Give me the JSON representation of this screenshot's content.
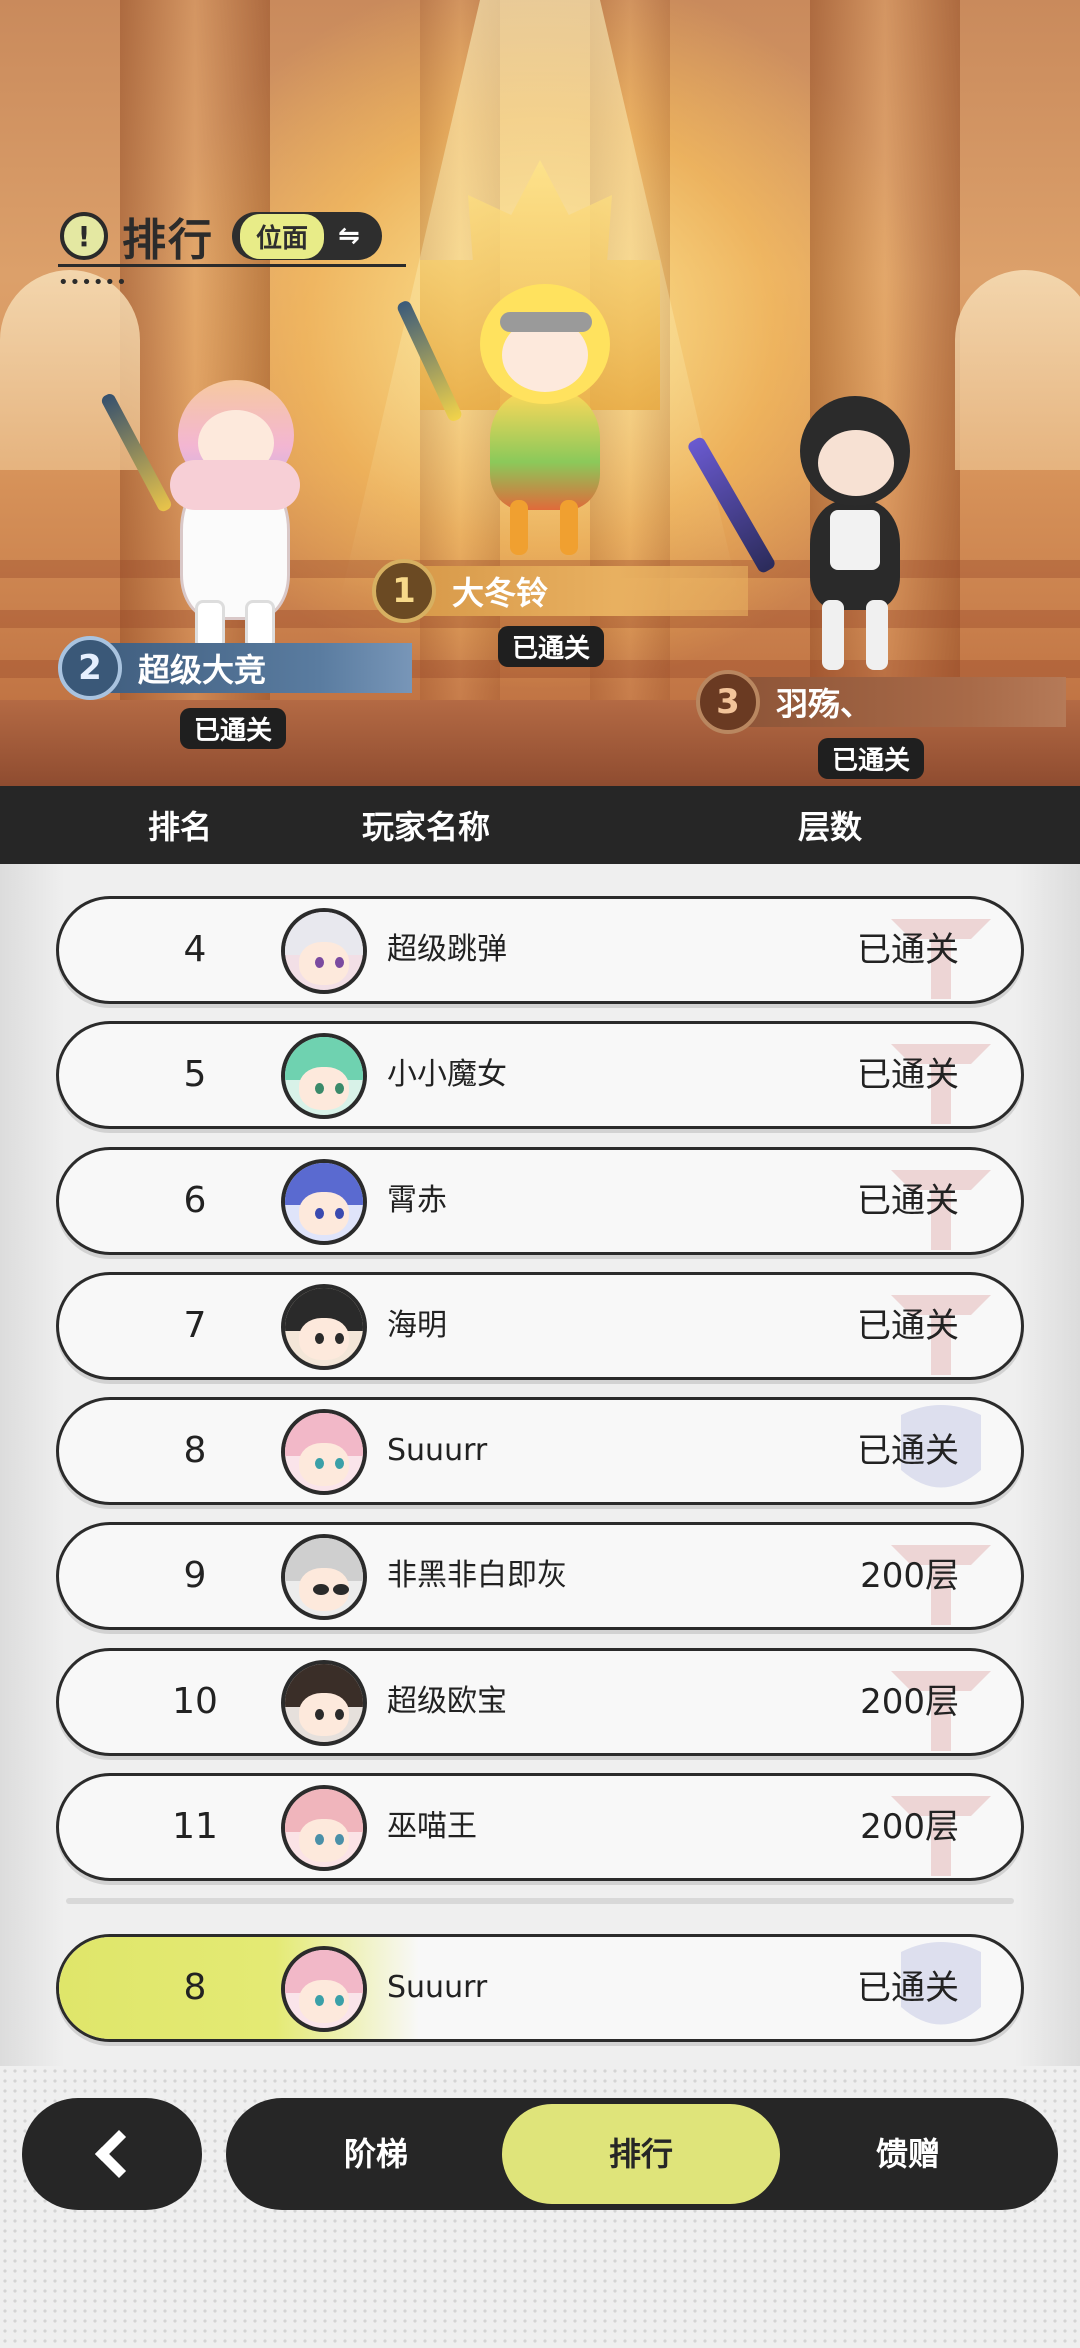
{
  "header": {
    "title": "排行",
    "scope_label": "位面",
    "swap_icon": "⇋",
    "info_icon": "!"
  },
  "podium": [
    {
      "rank": "1",
      "name": "大冬铃",
      "status": "已通关"
    },
    {
      "rank": "2",
      "name": "超级大竞",
      "status": "已通关"
    },
    {
      "rank": "3",
      "name": "羽殇、",
      "status": "已通关"
    }
  ],
  "table": {
    "col_rank": "排名",
    "col_name": "玩家名称",
    "col_floor": "层数"
  },
  "rows": [
    {
      "rank": "4",
      "name": "超级跳弹",
      "floor": "已通关"
    },
    {
      "rank": "5",
      "name": "小小魔女",
      "floor": "已通关"
    },
    {
      "rank": "6",
      "name": "霄赤",
      "floor": "已通关"
    },
    {
      "rank": "7",
      "name": "海明",
      "floor": "已通关"
    },
    {
      "rank": "8",
      "name": "Suuurr",
      "floor": "已通关"
    },
    {
      "rank": "9",
      "name": "非黑非白即灰",
      "floor": "200层"
    },
    {
      "rank": "10",
      "name": "超级欧宝",
      "floor": "200层"
    },
    {
      "rank": "11",
      "name": "巫喵王",
      "floor": "200层"
    }
  ],
  "my_row": {
    "rank": "8",
    "name": "Suuurr",
    "floor": "已通关"
  },
  "nav": {
    "back_icon": "chevron-left-icon",
    "tabs": [
      {
        "label": "阶梯",
        "active": false
      },
      {
        "label": "排行",
        "active": true
      },
      {
        "label": "馈赠",
        "active": false
      }
    ]
  },
  "colors": {
    "accent": "#dfe47a",
    "dark": "#262626",
    "gold": "#d9a24a"
  }
}
